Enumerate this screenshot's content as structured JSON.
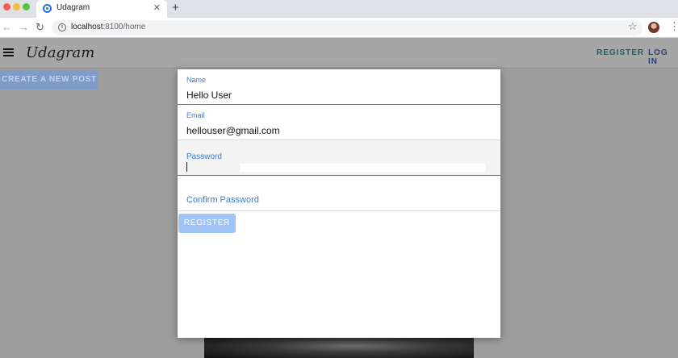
{
  "browser": {
    "tab_title": "Udagram",
    "tab_close": "✕",
    "new_tab": "+",
    "url_host": "localhost",
    "url_path": ":8100/home",
    "icons": {
      "back": "back-arrow-icon",
      "forward": "forward-arrow-icon",
      "reload": "reload-icon",
      "info": "info-icon",
      "bookmark": "star-icon",
      "menu": "kebab-menu-icon"
    }
  },
  "app": {
    "brand": "Udagram",
    "nav": {
      "register": "REGISTER",
      "login": "LOG IN"
    },
    "create_post": "CREATE A NEW POST",
    "colors": {
      "accent": "#3a7bd5",
      "error_underline": "#e53935",
      "register_button": "#9fc4f7"
    }
  },
  "register_form": {
    "name": {
      "label": "Name",
      "value": "Hello User"
    },
    "email": {
      "label": "Email",
      "value": "hellouser@gmail.com"
    },
    "password": {
      "label": "Password",
      "value": ""
    },
    "confirm_password": {
      "label": "Confirm Password",
      "value": ""
    },
    "submit": "REGISTER"
  }
}
